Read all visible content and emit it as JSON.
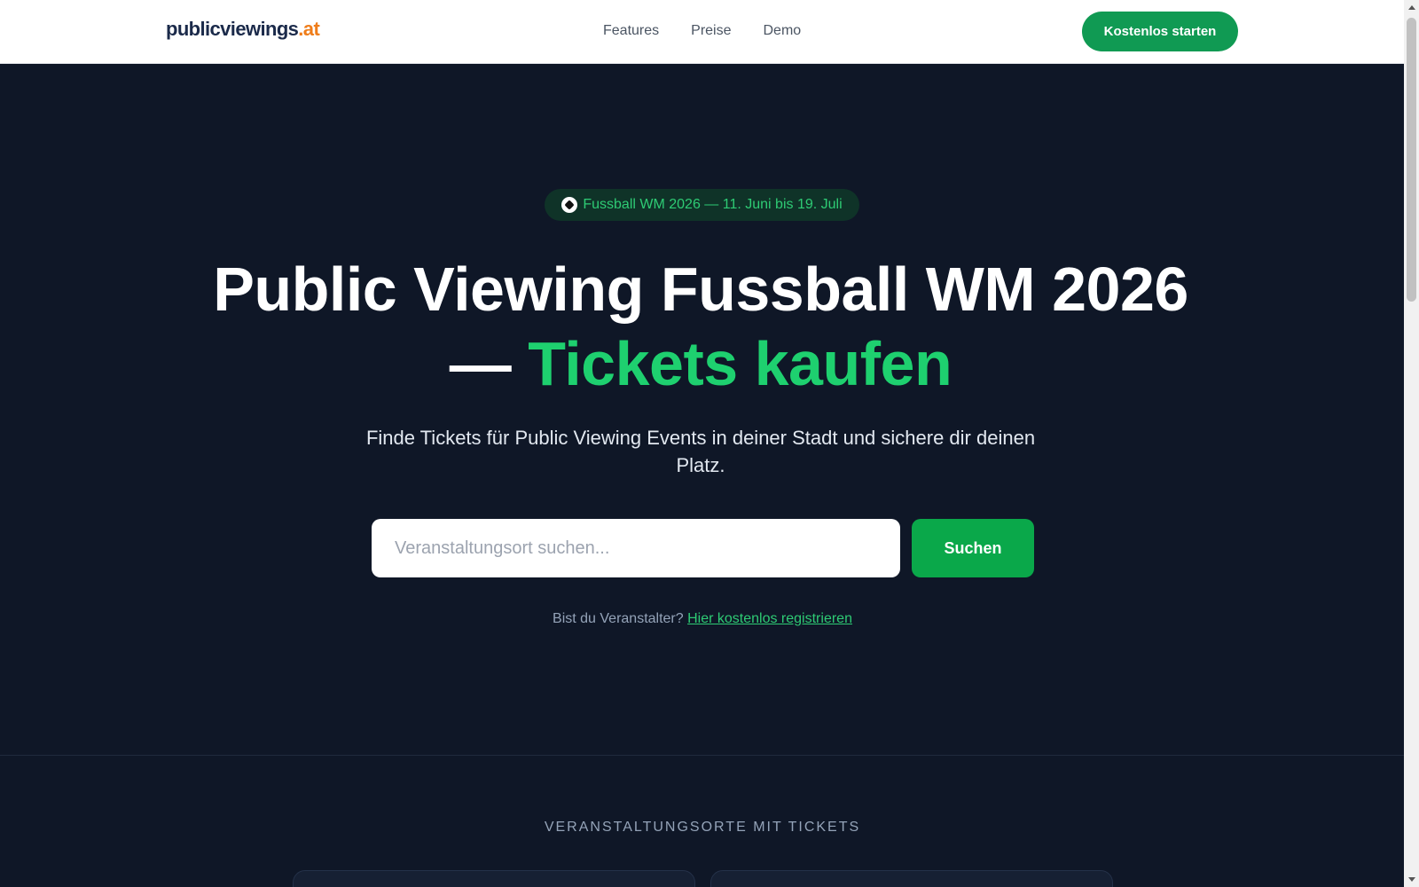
{
  "header": {
    "logo_main": "publicviewings",
    "logo_tld": ".at",
    "nav": [
      "Features",
      "Preise",
      "Demo"
    ],
    "cta_label": "Kostenlos starten"
  },
  "hero": {
    "badge_text": "Fussball WM 2026 — 11. Juni bis 19. Juli",
    "title_line": "Public Viewing Fussball WM 2026 —",
    "title_accent": "Tickets kaufen",
    "subtitle": "Finde Tickets für Public Viewing Events in deiner Stadt und sichere dir deinen Platz.",
    "search_placeholder": "Veranstaltungsort suchen...",
    "search_button": "Suchen",
    "organizer_text": "Bist du Veranstalter?",
    "organizer_link": "Hier kostenlos registrieren"
  },
  "venues": {
    "section_label": "VERANSTALTUNGSORTE MIT TICKETS"
  },
  "colors": {
    "brand_green": "#109a53",
    "accent_green": "#1ed06f",
    "logo_orange": "#ef7d1a",
    "hero_bg": "#0f1727"
  },
  "icons": {
    "badge_icon": "soccer-ball-icon"
  }
}
